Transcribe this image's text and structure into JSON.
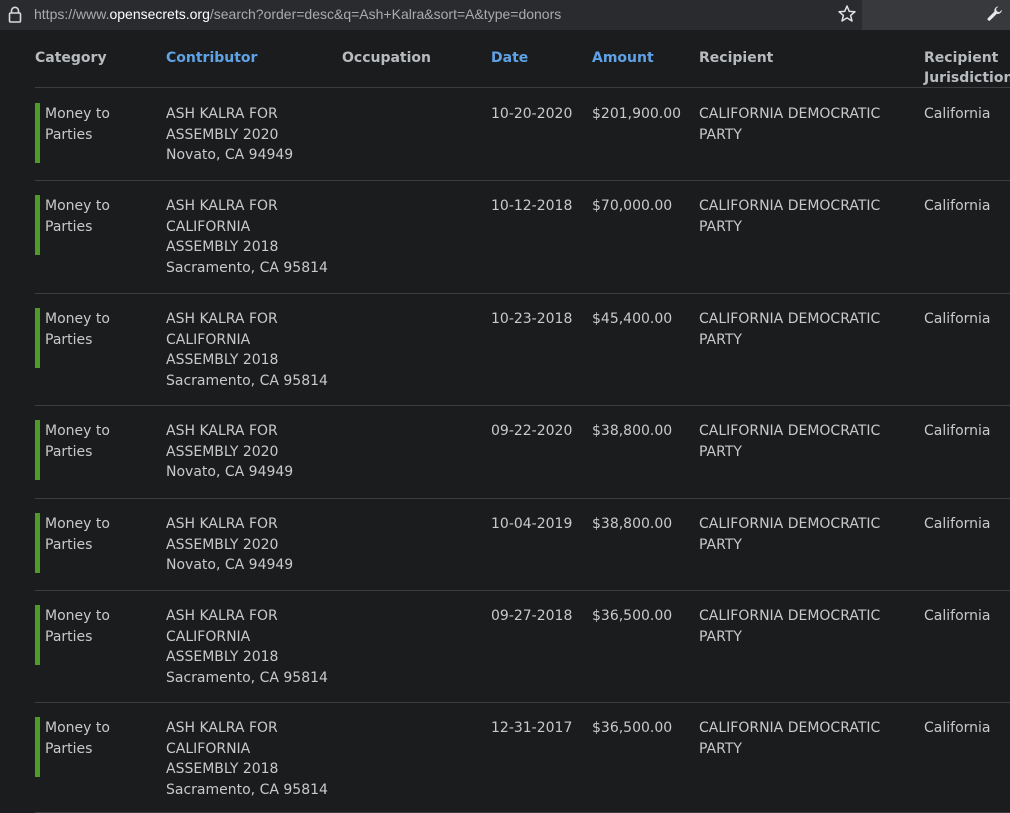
{
  "browser": {
    "url_prefix": "https://www.",
    "url_domain": "opensecrets.org",
    "url_path": "/search?order=desc&q=Ash+Kalra&sort=A&type=donors"
  },
  "table": {
    "headers": {
      "category": "Category",
      "contributor": "Contributor",
      "occupation": "Occupation",
      "date": "Date",
      "amount": "Amount",
      "recipient": "Recipient",
      "jurisdiction_line1": "Recipient",
      "jurisdiction_line2": "Jurisdiction"
    },
    "rows": [
      {
        "category": [
          "Money to",
          "Parties"
        ],
        "contributor": [
          "ASH KALRA FOR",
          "ASSEMBLY 2020",
          "Novato, CA 94949"
        ],
        "occupation": "",
        "date": "10-20-2020",
        "amount": "$201,900.00",
        "recipient": [
          "CALIFORNIA DEMOCRATIC",
          "PARTY"
        ],
        "jurisdiction": "California"
      },
      {
        "category": [
          "Money to",
          "Parties"
        ],
        "contributor": [
          "ASH KALRA FOR",
          "CALIFORNIA",
          "ASSEMBLY 2018",
          "Sacramento, CA 95814"
        ],
        "occupation": "",
        "date": "10-12-2018",
        "amount": "$70,000.00",
        "recipient": [
          "CALIFORNIA DEMOCRATIC",
          "PARTY"
        ],
        "jurisdiction": "California"
      },
      {
        "category": [
          "Money to",
          "Parties"
        ],
        "contributor": [
          "ASH KALRA FOR",
          "CALIFORNIA",
          "ASSEMBLY 2018",
          "Sacramento, CA 95814"
        ],
        "occupation": "",
        "date": "10-23-2018",
        "amount": "$45,400.00",
        "recipient": [
          "CALIFORNIA DEMOCRATIC",
          "PARTY"
        ],
        "jurisdiction": "California"
      },
      {
        "category": [
          "Money to",
          "Parties"
        ],
        "contributor": [
          "ASH KALRA FOR",
          "ASSEMBLY 2020",
          "Novato, CA 94949"
        ],
        "occupation": "",
        "date": "09-22-2020",
        "amount": "$38,800.00",
        "recipient": [
          "CALIFORNIA DEMOCRATIC",
          "PARTY"
        ],
        "jurisdiction": "California"
      },
      {
        "category": [
          "Money to",
          "Parties"
        ],
        "contributor": [
          "ASH KALRA FOR",
          "ASSEMBLY 2020",
          "Novato, CA 94949"
        ],
        "occupation": "",
        "date": "10-04-2019",
        "amount": "$38,800.00",
        "recipient": [
          "CALIFORNIA DEMOCRATIC",
          "PARTY"
        ],
        "jurisdiction": "California"
      },
      {
        "category": [
          "Money to",
          "Parties"
        ],
        "contributor": [
          "ASH KALRA FOR",
          "CALIFORNIA",
          "ASSEMBLY 2018",
          "Sacramento, CA 95814"
        ],
        "occupation": "",
        "date": "09-27-2018",
        "amount": "$36,500.00",
        "recipient": [
          "CALIFORNIA DEMOCRATIC",
          "PARTY"
        ],
        "jurisdiction": "California"
      },
      {
        "category": [
          "Money to",
          "Parties"
        ],
        "contributor": [
          "ASH KALRA FOR",
          "CALIFORNIA",
          "ASSEMBLY 2018",
          "Sacramento, CA 95814"
        ],
        "occupation": "",
        "date": "12-31-2017",
        "amount": "$36,500.00",
        "recipient": [
          "CALIFORNIA DEMOCRATIC",
          "PARTY"
        ],
        "jurisdiction": "California"
      }
    ]
  },
  "colors": {
    "category_bar": "#4f9a28",
    "sortable_header": "#5fa3e6"
  }
}
